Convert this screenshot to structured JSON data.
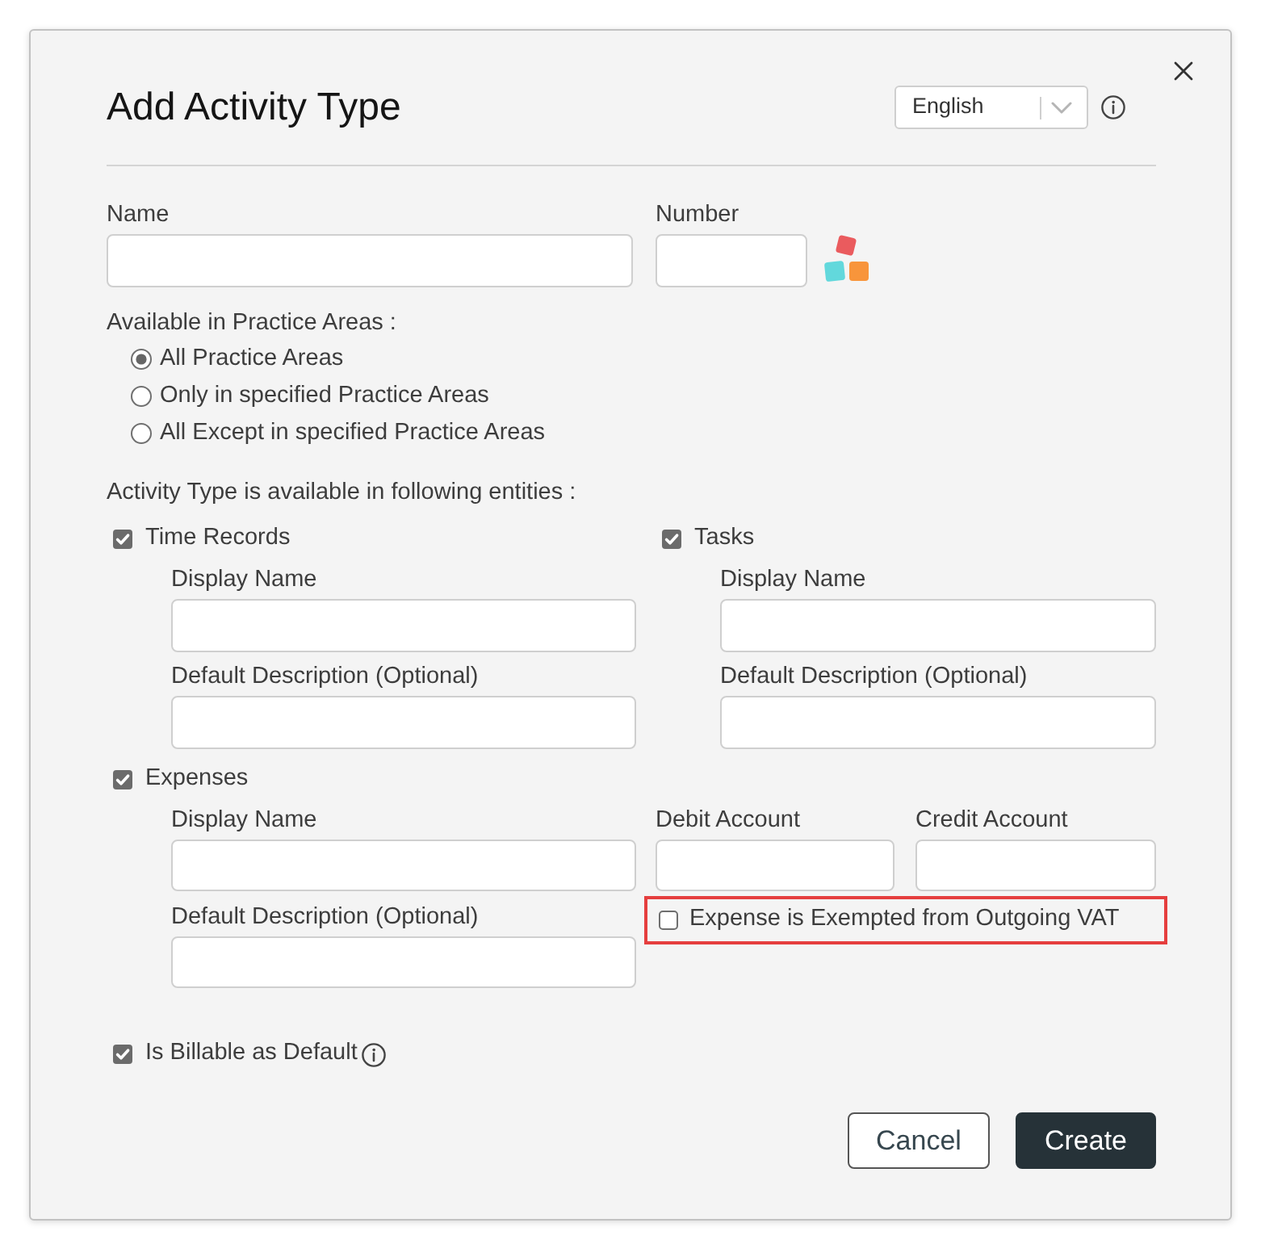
{
  "dialog": {
    "title": "Add Activity Type",
    "language": {
      "value": "English"
    }
  },
  "fields": [
    {
      "label": "Name",
      "kind": "text"
    },
    {
      "label": "Number",
      "kind": "number"
    }
  ],
  "practice_areas": {
    "label": "Available in Practice Areas :",
    "options": [
      {
        "label": "All Practice Areas",
        "selected": true
      },
      {
        "label": "Only in specified Practice Areas",
        "selected": false
      },
      {
        "label": "All Except in specified Practice Areas",
        "selected": false
      }
    ]
  },
  "entities": {
    "label": "Activity Type is available in following entities :",
    "items": [
      {
        "kind": "basic",
        "label": "Time Records",
        "checked": true,
        "fields": [
          {
            "label": "Display Name"
          },
          {
            "label": "Default Description (Optional)"
          }
        ]
      },
      {
        "kind": "basic",
        "label": "Tasks",
        "checked": true,
        "fields": [
          {
            "label": "Display Name"
          },
          {
            "label": "Default Description (Optional)"
          }
        ]
      },
      {
        "kind": "expense",
        "label": "Expenses",
        "checked": true,
        "fields": [
          {
            "label": "Display Name"
          },
          {
            "label": "Default Description (Optional)"
          }
        ],
        "accounts": [
          {
            "label": "Debit Account"
          },
          {
            "label": "Credit Account"
          }
        ],
        "vat_exempt": {
          "label": "Expense is Exempted from Outgoing VAT",
          "checked": false,
          "highlighted": true
        }
      }
    ]
  },
  "billable": {
    "label": "Is Billable as Default",
    "checked": true
  },
  "buttons": [
    {
      "label": "Cancel",
      "kind": "secondary"
    },
    {
      "label": "Create",
      "kind": "primary"
    }
  ]
}
